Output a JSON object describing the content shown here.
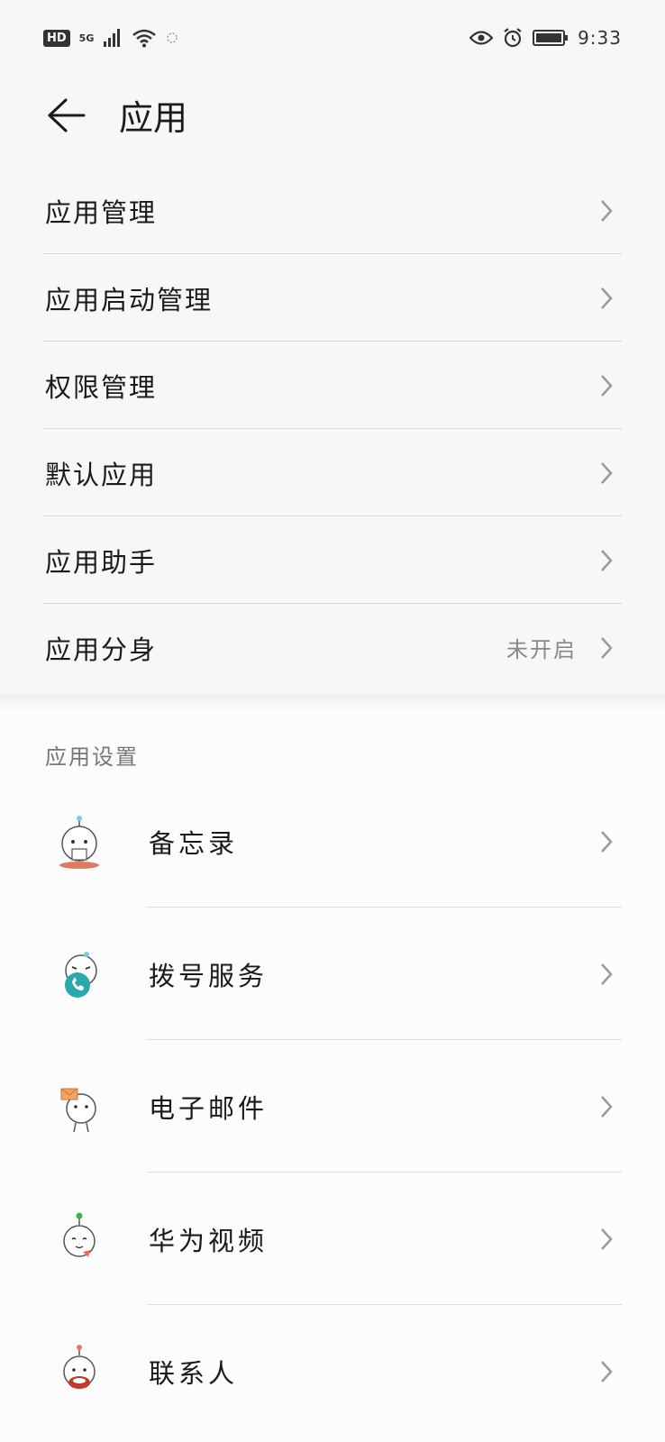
{
  "status_bar": {
    "hd": "HD",
    "network": "5G",
    "time": "9:33",
    "icons": [
      "signal-icon",
      "wifi-icon",
      "notification-icon",
      "eye-comfort-icon",
      "alarm-icon",
      "battery-icon"
    ]
  },
  "header": {
    "title": "应用",
    "back_icon": "back-arrow-icon"
  },
  "main_menu": [
    {
      "label": "应用管理"
    },
    {
      "label": "应用启动管理"
    },
    {
      "label": "权限管理"
    },
    {
      "label": "默认应用"
    },
    {
      "label": "应用助手"
    },
    {
      "label": "应用分身",
      "value": "未开启"
    }
  ],
  "app_settings": {
    "section_title": "应用设置",
    "items": [
      {
        "label": "备忘录",
        "icon": "notepad-app-icon"
      },
      {
        "label": "拨号服务",
        "icon": "dialer-app-icon"
      },
      {
        "label": "电子邮件",
        "icon": "email-app-icon"
      },
      {
        "label": "华为视频",
        "icon": "video-app-icon"
      },
      {
        "label": "联系人",
        "icon": "contacts-app-icon"
      }
    ]
  },
  "colors": {
    "background": "#f7f7f7",
    "text": "#1a1a1a",
    "secondary_text": "#888888",
    "divider": "#d8d8d8"
  }
}
